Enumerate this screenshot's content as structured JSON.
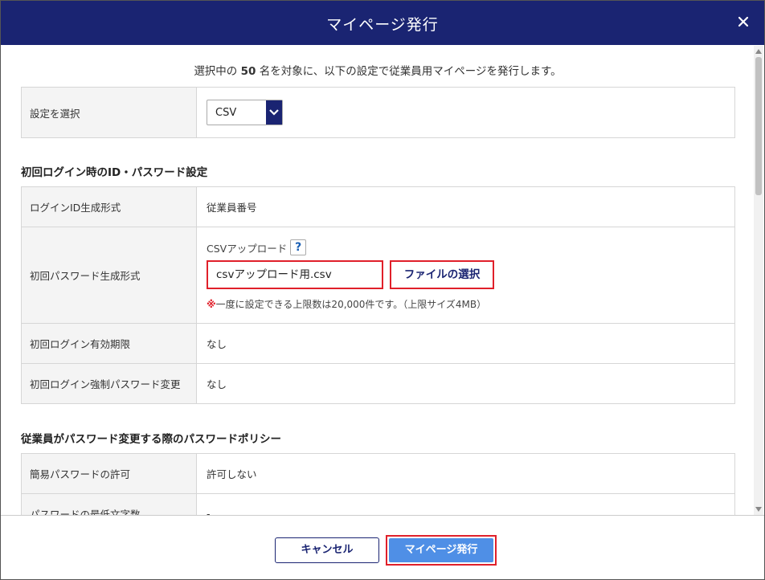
{
  "dialog": {
    "title": "マイページ発行",
    "close_icon": "close-icon"
  },
  "intro": {
    "prefix": "選択中の",
    "count": "50",
    "suffix": "名を対象に、以下の設定で従業員用マイページを発行します。"
  },
  "settings": {
    "label": "設定を選択",
    "selected": "CSV"
  },
  "login_section": {
    "heading": "初回ログイン時のID・パスワード設定",
    "rows": {
      "login_id": {
        "label": "ログインID生成形式",
        "value": "従業員番号"
      },
      "password": {
        "label": "初回パスワード生成形式",
        "upload_label": "CSVアップロード",
        "help": "?",
        "file_name": "csvアップロード用.csv",
        "file_button": "ファイルの選択",
        "note_mark": "※",
        "note": "一度に設定できる上限数は20,000件です。（上限サイズ4MB）"
      },
      "expiry": {
        "label": "初回ログイン有効期限",
        "value": "なし"
      },
      "force_change": {
        "label": "初回ログイン強制パスワード変更",
        "value": "なし"
      }
    }
  },
  "policy_section": {
    "heading": "従業員がパスワード変更する際のパスワードポリシー",
    "rows": {
      "simple": {
        "label": "簡易パスワードの許可",
        "value": "許可しない"
      },
      "min_length": {
        "label": "パスワードの最低文字数",
        "value": "-"
      }
    }
  },
  "footer": {
    "cancel_label": "キャンセル",
    "issue_label": "マイページ発行"
  },
  "colors": {
    "title_bar": "#1a2472",
    "highlight": "#e0202a",
    "primary_button": "#4f8fe6"
  }
}
